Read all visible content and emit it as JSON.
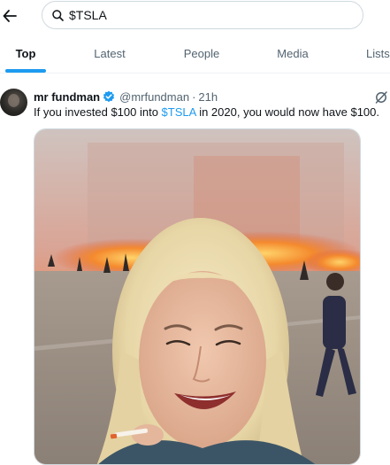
{
  "search": {
    "query": "$TSLA"
  },
  "tabs": [
    {
      "label": "Top",
      "active": true
    },
    {
      "label": "Latest",
      "active": false
    },
    {
      "label": "People",
      "active": false
    },
    {
      "label": "Media",
      "active": false
    },
    {
      "label": "Lists",
      "active": false
    }
  ],
  "tweet": {
    "author_name": "mr fundman",
    "handle": "@mrfundman",
    "separator": "·",
    "time": "21h",
    "text_before": "If you invested $100 into ",
    "cashtag": "$TSLA",
    "text_after": " in 2020, you would now have $100."
  },
  "colors": {
    "accent": "#1d9bf0",
    "text": "#0f1419",
    "muted": "#536471",
    "border": "#cfd9de"
  },
  "icons": [
    "back-arrow-icon",
    "search-icon",
    "verified-badge-icon",
    "grok-icon"
  ]
}
